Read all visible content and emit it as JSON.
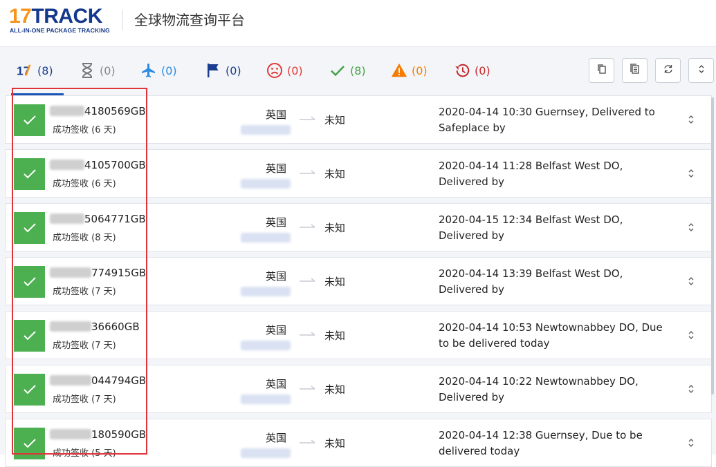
{
  "header": {
    "logo_main_num": "17",
    "logo_main_text": "TRACK",
    "logo_sub": "ALL-IN-ONE PACKAGE TRACKING",
    "title": "全球物流查询平台"
  },
  "tabs": [
    {
      "icon": "17track-logo-icon",
      "count": "(8)",
      "color": "#1a3d8f"
    },
    {
      "icon": "hourglass-icon",
      "count": "(0)",
      "color": "#888888"
    },
    {
      "icon": "airplane-icon",
      "count": "(0)",
      "color": "#2b8be0"
    },
    {
      "icon": "flag-icon",
      "count": "(0)",
      "color": "#1a3d8f"
    },
    {
      "icon": "sad-face-icon",
      "count": "(0)",
      "color": "#e53935"
    },
    {
      "icon": "checkmark-icon",
      "count": "(8)",
      "color": "#43a047"
    },
    {
      "icon": "warning-icon",
      "count": "(0)",
      "color": "#f57c00"
    },
    {
      "icon": "history-icon",
      "count": "(0)",
      "color": "#c62828"
    }
  ],
  "toolbar": {
    "copy_icon": "copy-icon",
    "copy_all_icon": "copy-list-icon",
    "refresh_icon": "refresh-icon",
    "expand_icon": "expand-all-icon"
  },
  "rows": [
    {
      "tracking": "4180569GB",
      "status": "成功签收 (6 天)",
      "origin": "英国",
      "destination": "未知",
      "event": "2020-04-14 10:30  Guernsey, Delivered to Safeplace by"
    },
    {
      "tracking": "4105700GB",
      "status": "成功签收 (6 天)",
      "origin": "英国",
      "destination": "未知",
      "event": "2020-04-14 11:28  Belfast West DO, Delivered by"
    },
    {
      "tracking": "5064771GB",
      "status": "成功签收 (8 天)",
      "origin": "英国",
      "destination": "未知",
      "event": "2020-04-15 12:34  Belfast West DO, Delivered by"
    },
    {
      "tracking": "774915GB",
      "status": "成功签收 (7 天)",
      "origin": "英国",
      "destination": "未知",
      "event": "2020-04-14 13:39  Belfast West DO, Delivered by"
    },
    {
      "tracking": "36660GB",
      "status": "成功签收 (7 天)",
      "origin": "英国",
      "destination": "未知",
      "event": "2020-04-14 10:53  Newtownabbey DO, Due to be delivered today"
    },
    {
      "tracking": "044794GB",
      "status": "成功签收 (7 天)",
      "origin": "英国",
      "destination": "未知",
      "event": "2020-04-14 10:22  Newtownabbey DO, Delivered by"
    },
    {
      "tracking": "180590GB",
      "status": "成功签收 (5 天)",
      "origin": "英国",
      "destination": "未知",
      "event": "2020-04-14 12:38  Guernsey, Due to be delivered today"
    }
  ]
}
